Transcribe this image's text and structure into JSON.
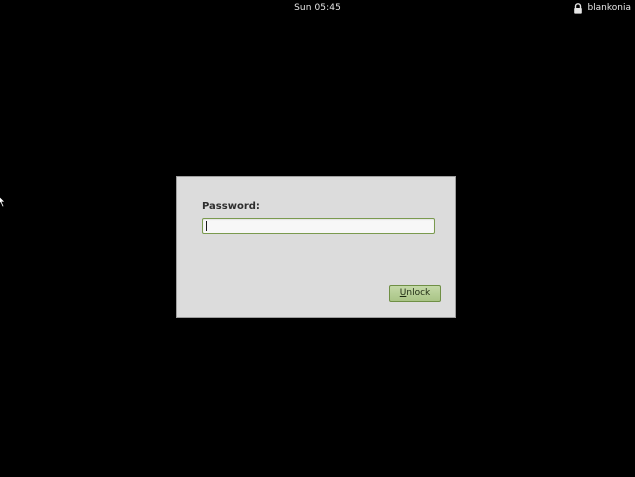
{
  "top_bar": {
    "clock": "Sun 05:45",
    "user_name": "blankonia",
    "lock_icon": "lock-icon"
  },
  "dialog": {
    "password_label": "Password:",
    "password_value": "",
    "unlock_button": {
      "mnemonic": "U",
      "rest": "nlock"
    }
  },
  "colors": {
    "background": "#000000",
    "dialog_bg": "#dcdcdc",
    "accent_green": "#a9c486",
    "input_border": "#7a9a4e",
    "panel_text": "#e6e6e6"
  }
}
